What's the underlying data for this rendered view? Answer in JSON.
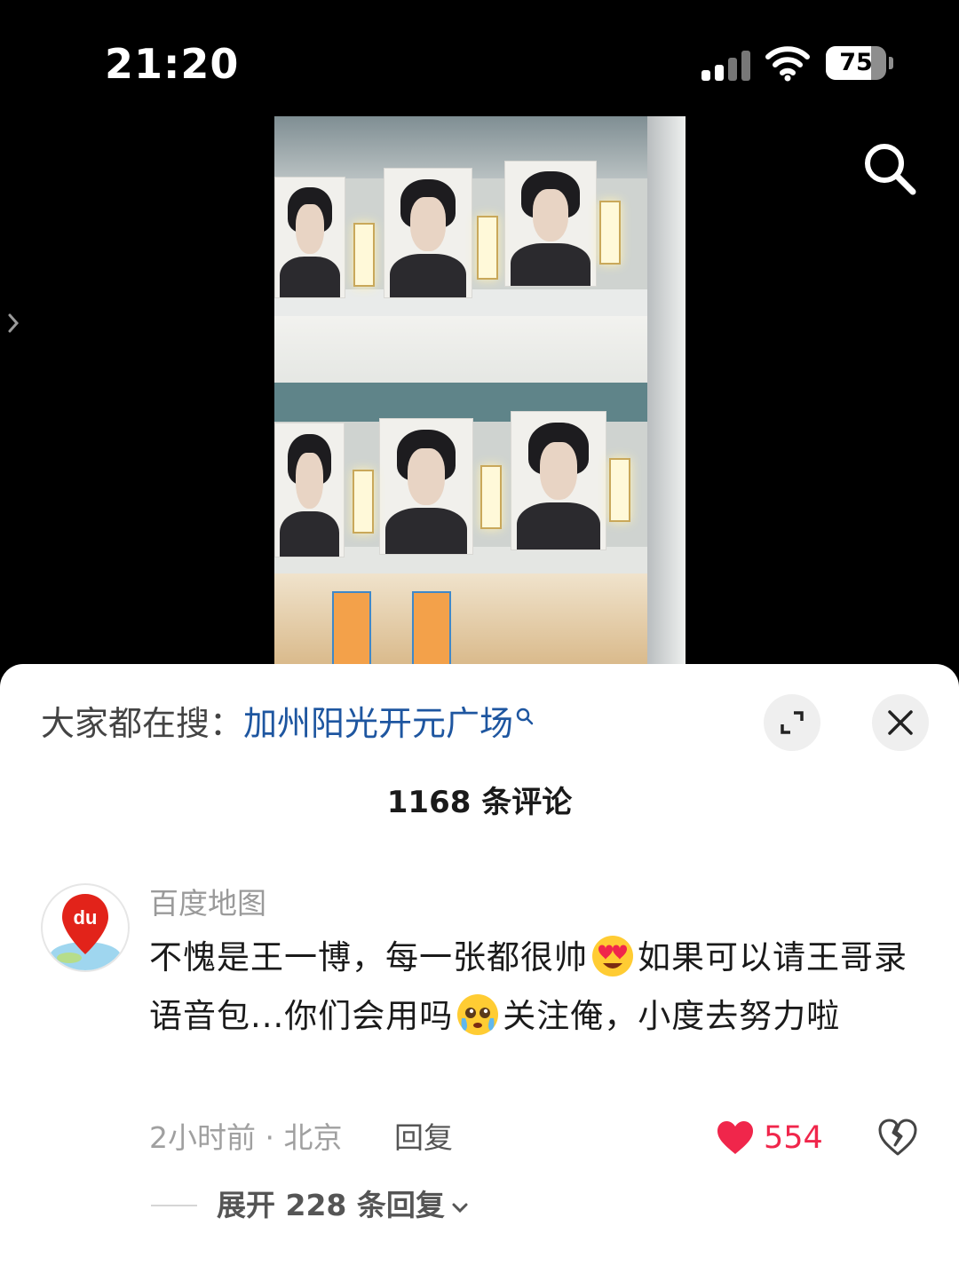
{
  "status_bar": {
    "time": "21:20",
    "battery_level": "75",
    "battery_fraction": 0.75,
    "icons": [
      "cellular-signal-icon",
      "wifi-icon",
      "battery-icon"
    ]
  },
  "top_controls": {
    "search_icon": "search-icon",
    "side_arrow_icon": "chevron-right-icon"
  },
  "video": {
    "description_icon": "video-frame"
  },
  "comment_sheet": {
    "hot_search_prefix": "大家都在搜：",
    "hot_search_keyword": "加州阳光开元广场",
    "expand_icon": "expand-icon",
    "close_icon": "close-icon",
    "comment_count": "1168 条评论",
    "comments": [
      {
        "username": "百度地图",
        "avatar_text": "du",
        "text_part1": "不愧是王一博，每一张都很帅",
        "text_part2": "如果可以请王哥录语音包...你们会用吗",
        "text_part3": "关注俺，小度去努力啦",
        "emoji1": "heart-eyes-emoji",
        "emoji2": "pleading-face-emoji",
        "meta": "2小时前 · 北京",
        "reply_label": "回复",
        "like_count": "554",
        "expand_replies": "展开 228 条回复"
      }
    ]
  },
  "colors": {
    "accent_link": "#1e56a0",
    "like_red": "#f0264b",
    "background_dark": "#000000",
    "sheet_bg": "#ffffff"
  }
}
